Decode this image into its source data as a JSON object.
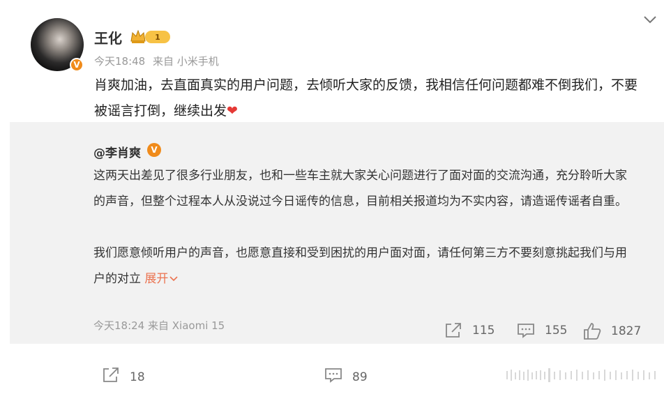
{
  "post": {
    "username": "王化",
    "member_level": "1",
    "time": "今天18:48",
    "source": "来自 小米手机",
    "text": "肖爽加油，去直面真实的用户问题，去倾听大家的反馈，我相信任何问题都难不倒我们，不要被谣言打倒，继续出发",
    "emoji": "❤"
  },
  "retweet": {
    "username": "@李肖爽",
    "paragraph1": "这两天出差见了很多行业朋友，也和一些车主就大家关心问题进行了面对面的交流沟通，充分聆听大家的声音，但整个过程本人从没说过今日谣传的信息，目前相关报道均为不实内容，请造谣传谣者自重。",
    "paragraph2": "我们愿意倾听用户的声音，也愿意直接和受到困扰的用户面对面，请任何第三方不要刻意挑起我们与用户的对立",
    "expand_label": "展开",
    "time": "今天18:24",
    "source": "来自 Xiaomi 15",
    "reposts": "115",
    "comments": "155",
    "likes": "1827"
  },
  "footer": {
    "reposts": "18",
    "comments": "89"
  },
  "badges": {
    "verified_letter": "V"
  },
  "icons": {
    "collapse": "chevron-down-icon",
    "repost": "repost-icon",
    "comment": "comment-icon",
    "like": "like-icon"
  },
  "colors": {
    "accent": "#eb7350",
    "verified": "#f08b1b",
    "heart": "#e53935",
    "retweet_bg": "#f2f2f2"
  }
}
